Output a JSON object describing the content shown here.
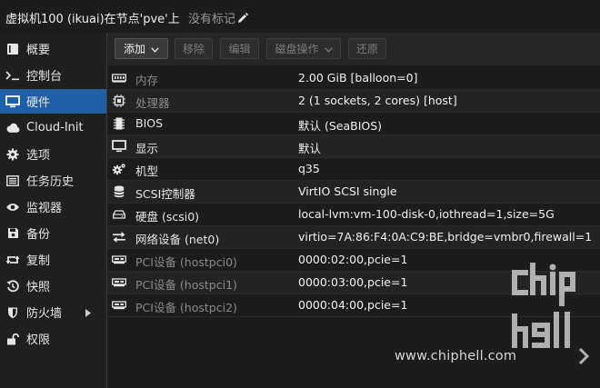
{
  "header": {
    "title": "虚拟机100 (ikuai)在节点'pve'上",
    "tags_label": "没有标记"
  },
  "sidebar": {
    "items": [
      {
        "label": "概要",
        "icon": "book-icon",
        "active": false
      },
      {
        "label": "控制台",
        "icon": "terminal-icon",
        "active": false
      },
      {
        "label": "硬件",
        "icon": "monitor-icon",
        "active": true
      },
      {
        "label": "Cloud-Init",
        "icon": "cloud-icon",
        "active": false
      },
      {
        "label": "选项",
        "icon": "gear-icon",
        "active": false
      },
      {
        "label": "任务历史",
        "icon": "list-icon",
        "active": false
      },
      {
        "label": "监视器",
        "icon": "eye-icon",
        "active": false
      },
      {
        "label": "备份",
        "icon": "floppy-icon",
        "active": false
      },
      {
        "label": "复制",
        "icon": "retweet-icon",
        "active": false
      },
      {
        "label": "快照",
        "icon": "history-icon",
        "active": false
      },
      {
        "label": "防火墙",
        "icon": "shield-icon",
        "active": false
      },
      {
        "label": "权限",
        "icon": "unlock-icon",
        "active": false
      }
    ]
  },
  "toolbar": {
    "add": "添加",
    "remove": "移除",
    "edit": "编辑",
    "disk_action": "磁盘操作",
    "revert": "还原"
  },
  "hardware": {
    "rows": [
      {
        "key": "内存",
        "value": "2.00 GiB [balloon=0]",
        "icon": "memory-icon"
      },
      {
        "key": "处理器",
        "value": "2 (1 sockets, 2 cores) [host]",
        "icon": "cpu-icon"
      },
      {
        "key": "BIOS",
        "value": "默认 (SeaBIOS)",
        "icon": "microchip-icon"
      },
      {
        "key": "显示",
        "value": "默认",
        "icon": "display-icon"
      },
      {
        "key": "机型",
        "value": "q35",
        "icon": "cogs-icon"
      },
      {
        "key": "SCSI控制器",
        "value": "VirtIO SCSI single",
        "icon": "database-icon"
      },
      {
        "key": "硬盘 (scsi0)",
        "value": "local-lvm:vm-100-disk-0,iothread=1,size=5G",
        "icon": "hdd-icon"
      },
      {
        "key": "网络设备 (net0)",
        "value": "virtio=7A:86:F4:0A:C9:BE,bridge=vmbr0,firewall=1",
        "icon": "exchange-icon"
      },
      {
        "key": "PCI设备 (hostpci0)",
        "value": "0000:02:00,pcie=1",
        "icon": "pci-icon"
      },
      {
        "key": "PCI设备 (hostpci1)",
        "value": "0000:03:00,pcie=1",
        "icon": "pci-icon"
      },
      {
        "key": "PCI设备 (hostpci2)",
        "value": "0000:04:00,pcie=1",
        "icon": "pci-icon"
      }
    ]
  },
  "watermark": {
    "url": "www.chiphell.com"
  }
}
